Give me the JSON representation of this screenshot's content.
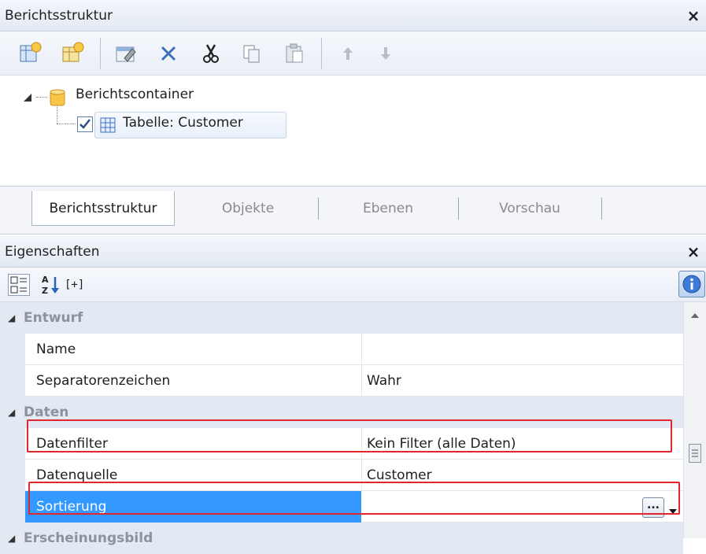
{
  "structure_panel": {
    "title": "Berichtsstruktur",
    "close_glyph": "×",
    "toolbar": [
      {
        "icon": "add-report-icon"
      },
      {
        "icon": "add-table-icon"
      },
      {
        "icon": "properties-icon"
      },
      {
        "icon": "delete-icon"
      },
      {
        "icon": "cut-icon"
      },
      {
        "icon": "copy-icon"
      },
      {
        "icon": "paste-icon"
      },
      {
        "icon": "move-up-icon"
      },
      {
        "icon": "move-down-icon"
      }
    ],
    "tree": {
      "root_label": "Berichtscontainer",
      "child_label": "Tabelle: Customer",
      "child_checked": true
    }
  },
  "tabs": [
    {
      "label": "Berichtsstruktur",
      "active": true
    },
    {
      "label": "Objekte",
      "active": false
    },
    {
      "label": "Ebenen",
      "active": false
    },
    {
      "label": "Vorschau",
      "active": false
    }
  ],
  "properties_panel": {
    "title": "Eigenschaften",
    "close_glyph": "×",
    "toolbar_expand_label": "[+]",
    "categories": {
      "entwurf": "Entwurf",
      "daten": "Daten",
      "erscheinungsbild": "Erscheinungsbild"
    },
    "rows": {
      "name": {
        "name": "Name",
        "value": ""
      },
      "separator": {
        "name": "Separatorenzeichen",
        "value": "Wahr"
      },
      "datenfilter": {
        "name": "Datenfilter",
        "value": "Kein Filter (alle Daten)"
      },
      "datenquelle": {
        "name": "Datenquelle",
        "value": "Customer"
      },
      "sortierung": {
        "name": "Sortierung",
        "value": "",
        "ellipsis": "..."
      }
    },
    "selected_color": "#3399ff",
    "highlight_color": "#e0262e"
  }
}
